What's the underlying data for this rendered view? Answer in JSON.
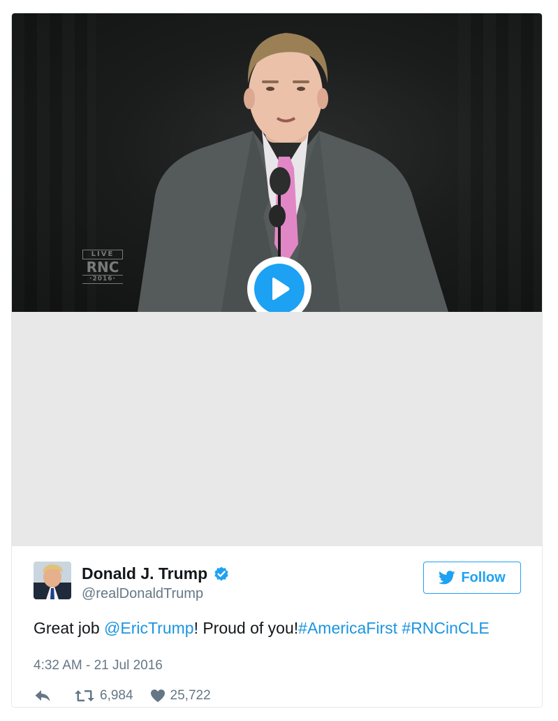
{
  "video": {
    "overlay": {
      "line1": "LIVE",
      "line2": "RNC",
      "line3": "·2016·"
    }
  },
  "tweet": {
    "author": {
      "name": "Donald J. Trump",
      "handle": "@realDonaldTrump",
      "verified": true
    },
    "follow_label": "Follow",
    "text": {
      "prefix": "Great job ",
      "mention": "@EricTrump",
      "middle": "! Proud of you!",
      "hashtag1": "#AmericaFirst",
      "space": " ",
      "hashtag2": "#RNCinCLE"
    },
    "timestamp": "4:32 AM - 21 Jul 2016",
    "retweets": "6,984",
    "likes": "25,722"
  },
  "colors": {
    "twitter_blue": "#1da1f2",
    "link_blue": "#1b95e0",
    "muted_gray": "#657786",
    "media_placeholder": "#e8e8e8"
  },
  "icons": {
    "play": "play-icon",
    "verified": "verified-badge-icon",
    "bird": "twitter-bird-icon",
    "reply": "reply-icon",
    "retweet": "retweet-icon",
    "like": "heart-icon"
  }
}
